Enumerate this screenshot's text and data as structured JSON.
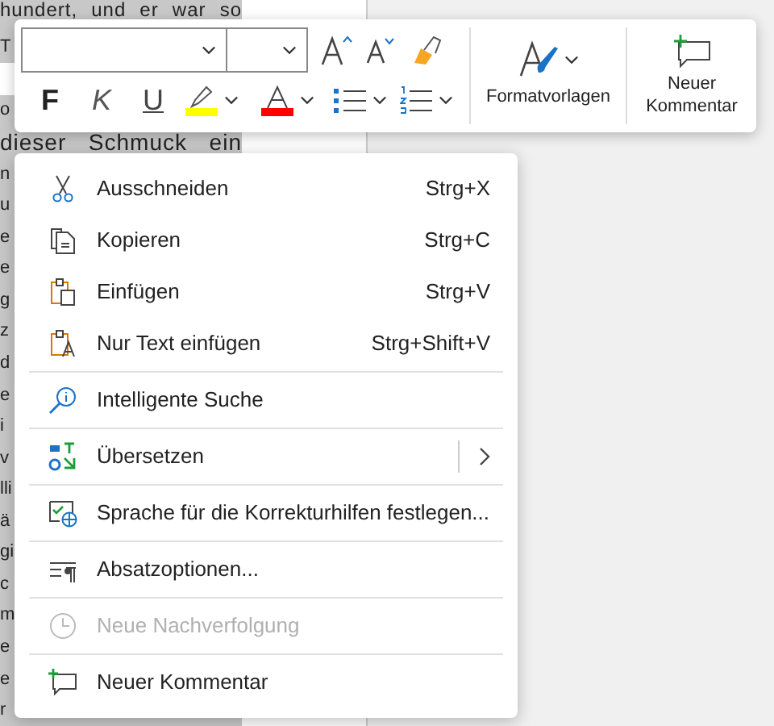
{
  "document": {
    "lines_above_toolbar": [
      "hundert, und er war so",
      "T"
    ],
    "lines": [
      "o",
      "dieser Schmuck ein",
      "n",
      "u",
      "e",
      "e",
      "g",
      "z",
      "d",
      "e",
      "i",
      "v",
      "lli",
      "ä",
      "gi",
      "c",
      "m",
      "e",
      "e",
      "r"
    ]
  },
  "toolbar": {
    "format_buttons": [
      {
        "label": "F",
        "kind": "bold"
      },
      {
        "label": "K",
        "kind": "italic"
      },
      {
        "label": "U",
        "kind": "underline"
      }
    ],
    "styles_button": {
      "label": "Formatvorlagen"
    },
    "comment_button": {
      "label": "Neuer Kommentar"
    }
  },
  "context_menu": {
    "groups": [
      [
        {
          "label": "Ausschneiden",
          "shortcut": "Strg+X",
          "disabled": false,
          "submenu": false
        },
        {
          "label": "Kopieren",
          "shortcut": "Strg+C",
          "disabled": false,
          "submenu": false
        },
        {
          "label": "Einfügen",
          "shortcut": "Strg+V",
          "disabled": false,
          "submenu": false
        },
        {
          "label": "Nur Text einfügen",
          "shortcut": "Strg+Shift+V",
          "disabled": false,
          "submenu": false
        }
      ],
      [
        {
          "label": "Intelligente Suche",
          "disabled": false,
          "submenu": false
        }
      ],
      [
        {
          "label": "Übersetzen",
          "disabled": false,
          "submenu": true
        }
      ],
      [
        {
          "label": "Sprache für die Korrekturhilfen festlegen...",
          "disabled": false,
          "submenu": false
        }
      ],
      [
        {
          "label": "Absatzoptionen...",
          "disabled": false,
          "submenu": false
        }
      ],
      [
        {
          "label": "Neue Nachverfolgung",
          "disabled": true,
          "submenu": false
        }
      ],
      [
        {
          "label": "Neuer Kommentar",
          "disabled": false,
          "submenu": false
        }
      ]
    ]
  }
}
